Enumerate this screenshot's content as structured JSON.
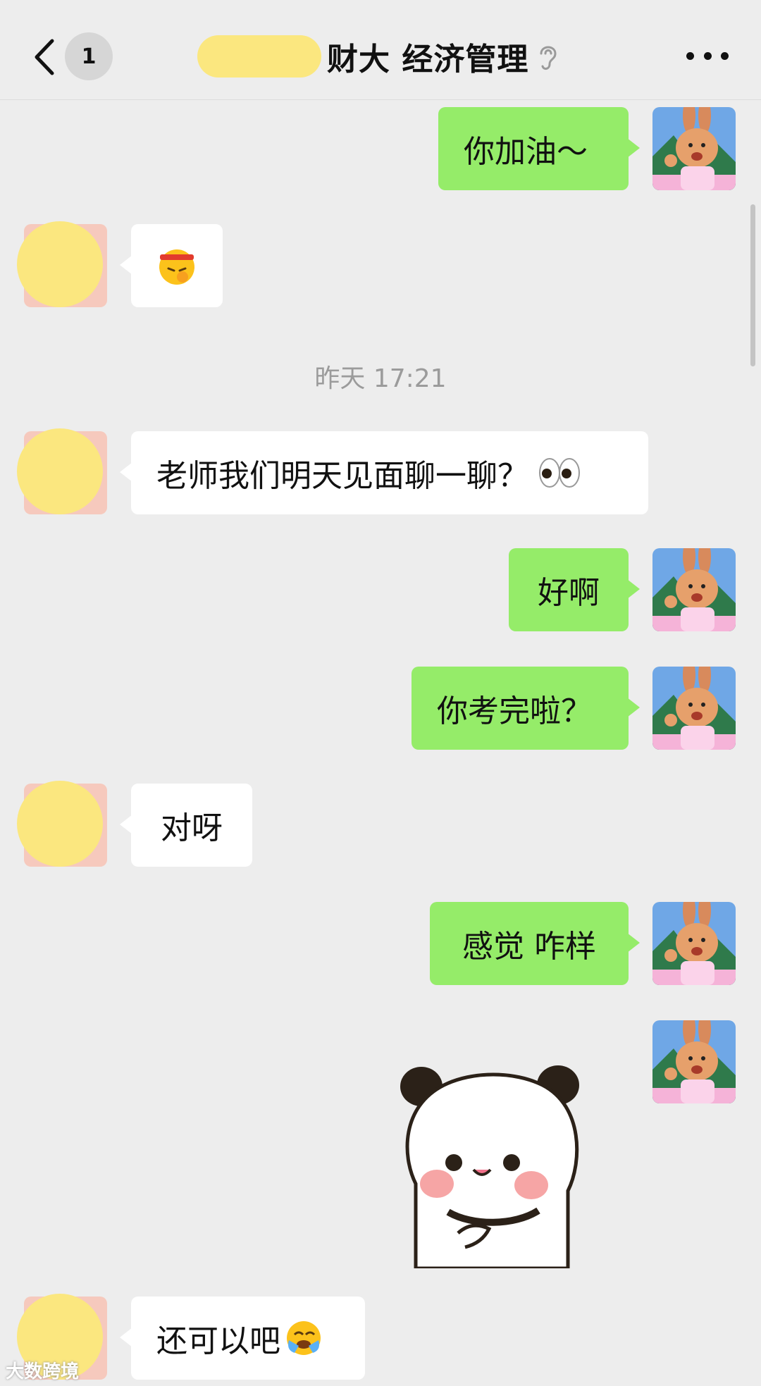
{
  "header": {
    "unread_count": "1",
    "title": "财大 经济管理"
  },
  "messages": {
    "m1": "你加油～",
    "timestamp": "昨天 17:21",
    "m3": "老师我们明天见面聊一聊？",
    "m4": "好啊",
    "m5": "你考完啦？",
    "m6": "对呀",
    "m7": "感觉 咋样",
    "m9": "还可以吧"
  },
  "icons": {
    "back": "chevron-left-icon",
    "ear": "ear-icon",
    "more": "more-dots-icon"
  },
  "colors": {
    "outgoing_bubble": "#95ec69",
    "incoming_bubble": "#ffffff",
    "background": "#ededed"
  },
  "watermark": "大数跨境"
}
